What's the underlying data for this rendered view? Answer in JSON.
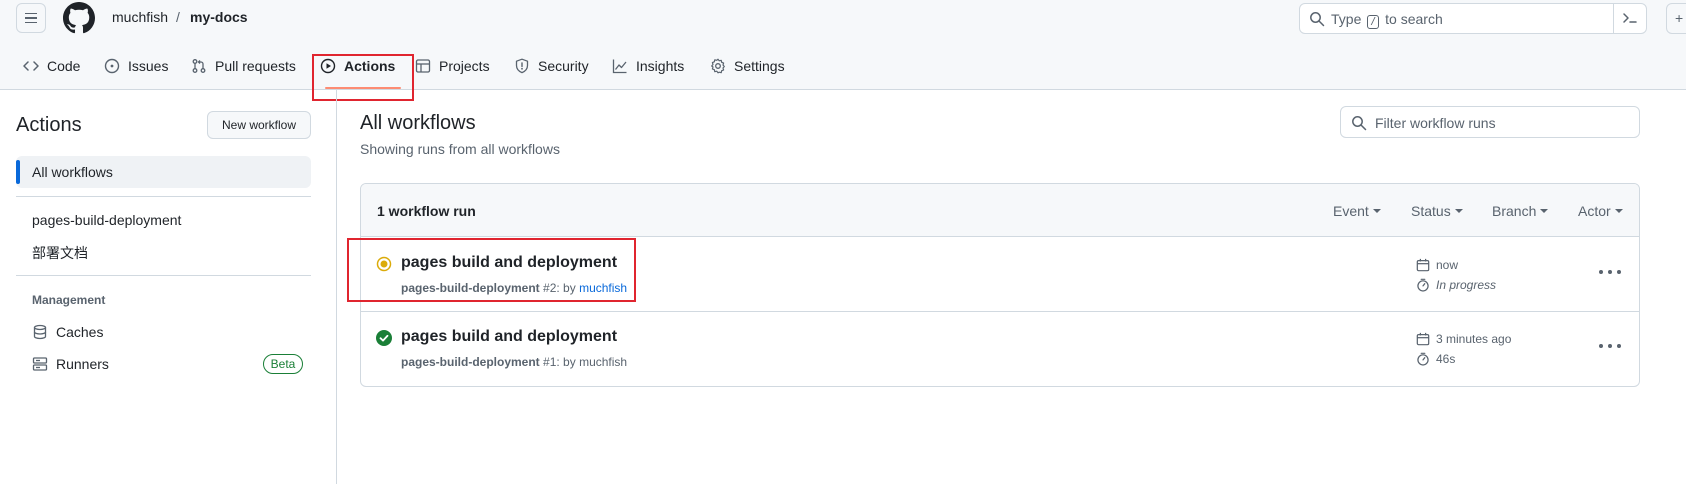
{
  "header": {
    "owner": "muchfish",
    "separator": "/",
    "repo": "my-docs",
    "search": {
      "prefix": "Type",
      "key": "/",
      "suffix": "to search"
    },
    "tabs": [
      {
        "label": "Code",
        "icon": "code-icon"
      },
      {
        "label": "Issues",
        "icon": "issue-opened-icon"
      },
      {
        "label": "Pull requests",
        "icon": "git-pull-request-icon"
      },
      {
        "label": "Actions",
        "icon": "play-icon",
        "selected": true
      },
      {
        "label": "Projects",
        "icon": "table-icon"
      },
      {
        "label": "Security",
        "icon": "shield-icon"
      },
      {
        "label": "Insights",
        "icon": "graph-icon"
      },
      {
        "label": "Settings",
        "icon": "gear-icon"
      }
    ]
  },
  "sidebar": {
    "title": "Actions",
    "new_workflow": "New workflow",
    "all_workflows": "All workflows",
    "workflows": [
      "pages-build-deployment",
      "部署文档"
    ],
    "management_heading": "Management",
    "management": [
      {
        "label": "Caches",
        "icon": "database-icon"
      },
      {
        "label": "Runners",
        "icon": "server-icon",
        "badge": "Beta"
      }
    ]
  },
  "main": {
    "title": "All workflows",
    "subtitle": "Showing runs from all workflows",
    "filter_placeholder": "Filter workflow runs",
    "runs_count": "1 workflow run",
    "filters": [
      "Event",
      "Status",
      "Branch",
      "Actor"
    ],
    "runs": [
      {
        "title": "pages build and deployment",
        "workflow": "pages-build-deployment",
        "number": "#2: by",
        "actor": "muchfish",
        "when": "now",
        "duration": "In progress",
        "status": "in-progress"
      },
      {
        "title": "pages build and deployment",
        "workflow": "pages-build-deployment",
        "number": "#1: by",
        "actor": "muchfish",
        "when": "3 minutes ago",
        "duration": "46s",
        "status": "success"
      }
    ]
  },
  "colors": {
    "accent": "#0969da",
    "success": "#1a7f37",
    "in_progress": "#dbab0a",
    "tab_underline": "#fd8c73",
    "highlight_box": "#e0252f"
  }
}
